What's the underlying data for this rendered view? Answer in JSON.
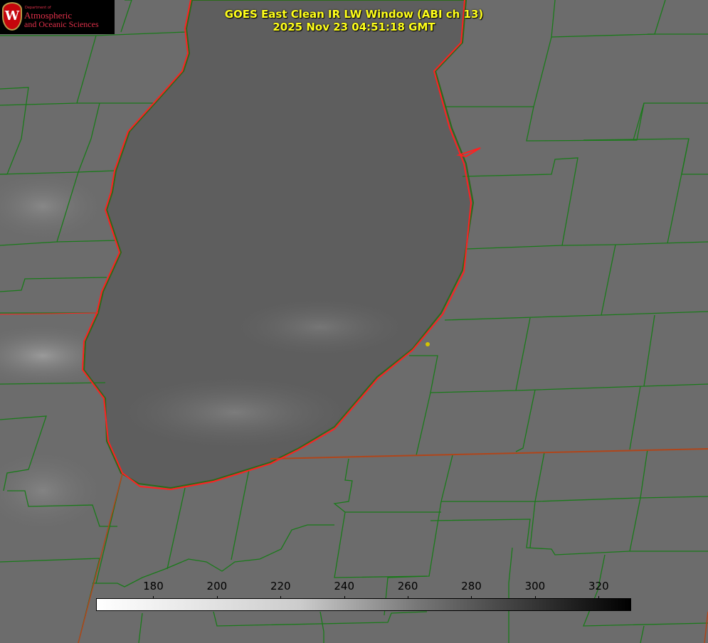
{
  "title": {
    "line1": "GOES East Clean IR LW Window (ABI ch 13)",
    "line2": "2025 Nov 23 04:51:18 GMT"
  },
  "logo": {
    "crest_letter": "W",
    "department": "Department of",
    "line1": "Atmospheric",
    "line2": "and Oceanic Sciences"
  },
  "colorbar": {
    "ticks": [
      "180",
      "200",
      "220",
      "240",
      "260",
      "280",
      "300",
      "320"
    ],
    "tick_values": [
      180,
      200,
      220,
      240,
      260,
      280,
      300,
      320
    ],
    "range": [
      162,
      330
    ],
    "units_implied": "K"
  },
  "colors": {
    "county_lines": "#1a7a1a",
    "shoreline": "#ff2020",
    "title": "#ffff1a",
    "marker": "#d4c400"
  }
}
